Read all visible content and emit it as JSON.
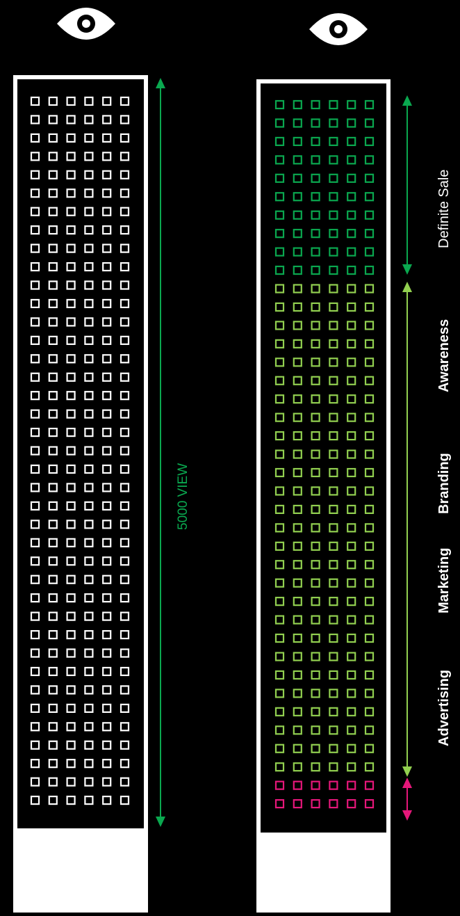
{
  "annotations": {
    "view_label": "5000 VIEW",
    "definite_sale": "Definite Sale",
    "funnel_terms": [
      "Awareness",
      "Branding",
      "Marketing",
      "Advertising"
    ]
  },
  "grid": {
    "columns": 6,
    "left_rows": 39,
    "right_segments": [
      {
        "name": "sale",
        "rows": 10,
        "color": "#0aa84f"
      },
      {
        "name": "awareness",
        "rows": 27,
        "color": "#92d050"
      },
      {
        "name": "rest",
        "rows": 2,
        "color": "#e6177a"
      }
    ],
    "left_color": "#ffffff"
  },
  "colors": {
    "background": "#000000",
    "frame": "#ffffff",
    "green_dark": "#0aa84f",
    "green_light": "#92d050",
    "magenta": "#e6177a"
  },
  "icons": [
    "eye-icon",
    "eye-icon"
  ]
}
